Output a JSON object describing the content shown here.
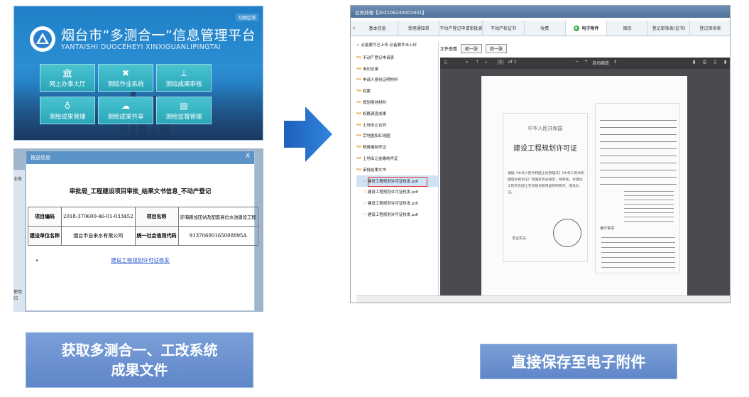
{
  "portal": {
    "title": "烟台市“多测合一”信息管理平台",
    "subtitle": "YANTAISHI DUOCEHEYI XINXIGUANLIPINGTAI",
    "top_button": "切换区域",
    "tiles": [
      {
        "label": "网上办事大厅",
        "icon": "building-icon"
      },
      {
        "label": "测绘作业系统",
        "icon": "tools-icon"
      },
      {
        "label": "测绘成果审核",
        "icon": "stamp-icon"
      },
      {
        "label": "测绘成果管理",
        "icon": "folder-icon"
      },
      {
        "label": "测绘成果共享",
        "icon": "share-icon"
      },
      {
        "label": "测绘监督管理",
        "icon": "supervise-icon"
      }
    ]
  },
  "dialog": {
    "header": "推送信息",
    "close": "X",
    "title": "审批局_工程建设项目审批_结果文书信息_不动产登记",
    "rows": [
      [
        "项目编码",
        "2018-370600-46-01-033452",
        "项目名称",
        "迎海路加压站及配套高位水池建设工程"
      ],
      [
        "建设单位名称",
        "烟台市自来水有限公司",
        "统一社会信用代码",
        "91370600165008895A"
      ]
    ],
    "link": "建设工程规划许可证核发",
    "bullet": "•",
    "side_labels": [
      "业务",
      "使用归"
    ]
  },
  "caption_left": {
    "line1": "获取多测合一、工改系统",
    "line2": "成果文件"
  },
  "caption_right": "直接保存至电子附件",
  "app": {
    "title": "业务处理【202108240001931】",
    "tabs": [
      "基本信息",
      "受理通知单",
      "不动产登记申请审批表",
      "不动产权证书",
      "收费",
      "电子附件",
      "图形",
      "登记审核表(证书)",
      "登记审核表"
    ],
    "active_tab": "电子附件",
    "tree_header": "必备要件已上传  必备要件未上传",
    "tree": [
      {
        "label": "不动产登记申请表",
        "type": "folder"
      },
      {
        "label": "询问记录",
        "type": "folder"
      },
      {
        "label": "申请人身份证明材料",
        "type": "folder"
      },
      {
        "label": "权属",
        "type": "folder"
      },
      {
        "label": "规划用地材料",
        "type": "folder"
      },
      {
        "label": "权籍调查成果",
        "type": "folder"
      },
      {
        "label": "土地出让合同",
        "type": "folder"
      },
      {
        "label": "宗地图和红线图",
        "type": "folder"
      },
      {
        "label": "税费缴纳凭证",
        "type": "folder"
      },
      {
        "label": "土地出让金缴纳凭证",
        "type": "folder"
      },
      {
        "label": "审批结果文书",
        "type": "folder"
      },
      {
        "label": "建设工程规划许可证核发.pdf",
        "type": "file"
      },
      {
        "label": "建设工程规划许可证核发.pdf",
        "type": "file"
      },
      {
        "label": "建设工程规划许可证核发.pdf",
        "type": "file"
      },
      {
        "label": "建设工程规划许可证核发.pdf",
        "type": "file"
      }
    ],
    "viewer": {
      "label": "文件查看",
      "prev": "前一张",
      "next": "后一张",
      "page_num": "1",
      "page_total": "of 1",
      "zoom": "自动缩放",
      "doc_heading": "中华人民共和国",
      "doc_title": "建设工程规划许可证",
      "doc_body": "根据《中华人民共和国土地管理法》《中华人民共和国城乡规划法》和国家有关规定，经审核，本建设工程符合国土空间规划和用途管制要求，颁发此证。",
      "doc_sign": "发证机关",
      "doc_notes": "遵守事项"
    }
  }
}
